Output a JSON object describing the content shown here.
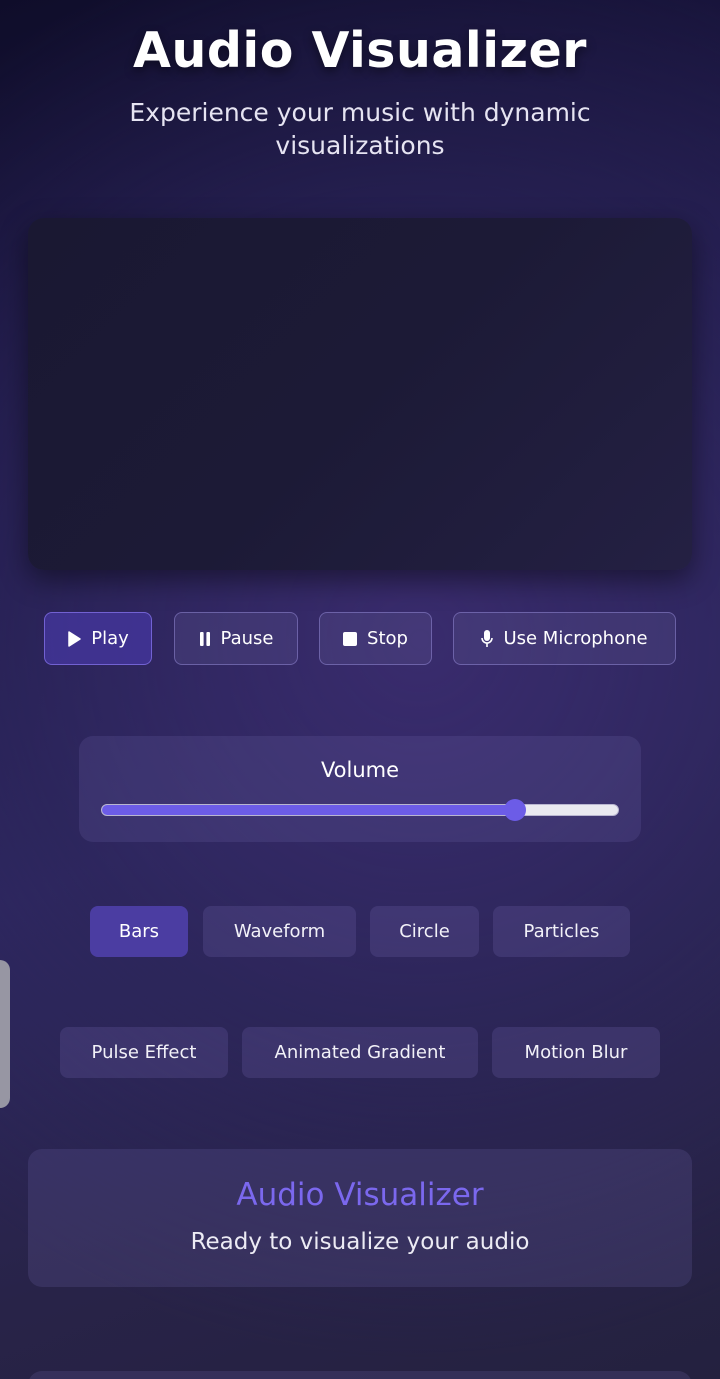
{
  "header": {
    "title": "Audio Visualizer",
    "subtitle": "Experience your music with dynamic visualizations"
  },
  "controls": {
    "play_label": "Play",
    "pause_label": "Pause",
    "stop_label": "Stop",
    "microphone_label": "Use Microphone"
  },
  "volume": {
    "label": "Volume",
    "value_fraction": 0.8
  },
  "visualization_types": [
    "Bars",
    "Waveform",
    "Circle",
    "Particles"
  ],
  "active_visualization": "Bars",
  "effects": [
    "Pulse Effect",
    "Animated Gradient",
    "Motion Blur"
  ],
  "info": {
    "title": "Audio Visualizer",
    "status": "Ready to visualize your audio"
  },
  "colors": {
    "accent": "#6c5ce7",
    "info_title": "#7b68ee"
  },
  "icons": {
    "play": "play-icon",
    "pause": "pause-icon",
    "stop": "stop-icon",
    "microphone": "microphone-icon"
  }
}
